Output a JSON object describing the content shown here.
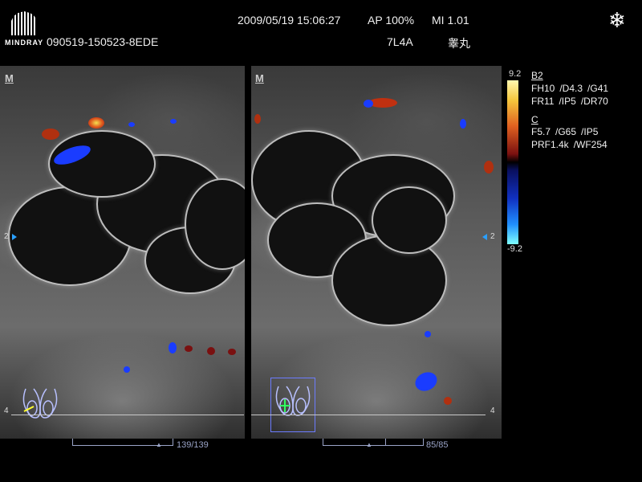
{
  "header": {
    "brand": "MINDRAY",
    "patient_id": "090519-150523-8EDE",
    "datetime": "2009/05/19 15:06:27",
    "ap": "AP 100%",
    "mi": "MI 1.01",
    "probe": "7L4A",
    "exam_part": "睾丸",
    "freeze_icon": "snowflake-icon"
  },
  "panes": {
    "left": {
      "marker": "M",
      "depth_2": "2",
      "depth_4": "4",
      "frame": "139/139"
    },
    "right": {
      "marker": "M",
      "depth_2": "2",
      "depth_4": "4",
      "frame": "85/85"
    }
  },
  "color_scale": {
    "max": "9.2",
    "min": "-9.2"
  },
  "params": {
    "b_mode_title": "B2",
    "b_row1": [
      "FH10",
      "/D4.3",
      "/G41"
    ],
    "b_row2": [
      "FR11",
      "/IP5",
      "/DR70"
    ],
    "c_mode_title": "C",
    "c_row1": [
      "F5.7",
      "/G65",
      "/IP5"
    ],
    "c_row2": [
      "PRF1.4k",
      "/WF254"
    ]
  },
  "colors": {
    "cine_bar": "#9aa4c8",
    "doppler_blue": "#1a3cff",
    "doppler_red": "#c02010"
  }
}
